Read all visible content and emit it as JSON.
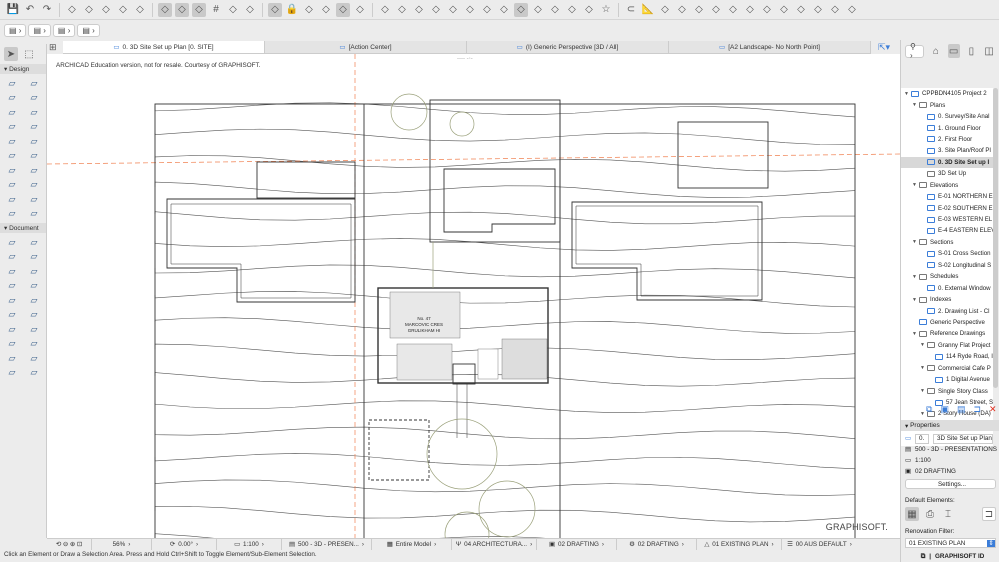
{
  "toolbar": {
    "row1_icons": [
      "save-icon",
      "undo-icon",
      "redo-icon",
      "find-select-icon",
      "marquee-icon",
      "magic-wand-icon",
      "eyedropper-icon",
      "syringe-icon",
      "guide-lines-icon",
      "snap-guides-icon",
      "grid-snap-icon",
      "grid-icon",
      "trace-icon",
      "trace-reference-icon",
      "layer-combo-icon",
      "lock-icon",
      "group-icon",
      "renovation-icon",
      "graphic-override-icon",
      "suspend-groups-icon",
      "intersect-icon",
      "trim-icon",
      "align-icon",
      "corner-icon",
      "fillet-icon",
      "split-icon",
      "roof-icon",
      "mirror-icon",
      "rotate-icon",
      "drag-icon",
      "elevate-icon",
      "offset-icon",
      "resize-icon",
      "star-icon",
      "magnet-icon",
      "ruler-icon",
      "3d-explore-icon",
      "layout-icon",
      "bookmark-icon",
      "tag-icon",
      "label-icon",
      "teamwork-icon",
      "send-icon",
      "receive-icon",
      "publish-icon",
      "reserve-icon",
      "release-icon",
      "sync-icon"
    ],
    "row2_pills": [
      "layers-dropdown",
      "pen-dropdown",
      "3d-view-dropdown",
      "arrow-dropdown"
    ]
  },
  "tabs": [
    {
      "label": "0. 3D Site Set up Plan [0. SITE]",
      "icon": "floor-plan-icon"
    },
    {
      "label": "[Action Center]",
      "icon": "action-center-icon"
    },
    {
      "label": "(I) Generic Perspective [3D / All]",
      "icon": "3d-window-icon"
    },
    {
      "label": "[A2 Landscape- No North Point]",
      "icon": "layout-sheet-icon"
    }
  ],
  "toolbox": {
    "design_label": "Design",
    "document_label": "Document",
    "design_tools": [
      "wall-tool",
      "column-tool",
      "beam-tool",
      "window-tool",
      "door-tool",
      "curtain-wall-tool",
      "slab-tool",
      "roof-tool",
      "stair-tool",
      "railing-tool",
      "shell-tool",
      "skylight-tool",
      "morph-tool",
      "object-tool",
      "mesh-tool",
      "zone-tool",
      "lamp-tool",
      "beam-grid-tool",
      "truss-tool",
      "opening-tool"
    ],
    "document_tools": [
      "dimension-tool",
      "level-dimension-tool",
      "radial-dimension-tool",
      "text-tool",
      "label-tool",
      "fill-tool",
      "line-tool",
      "arc-tool",
      "polyline-tool",
      "spline-tool",
      "hotspot-tool",
      "section-tool",
      "elevation-tool",
      "interior-elevation-tool",
      "worksheet-tool",
      "detail-tool",
      "change-tool",
      "grid-element-tool",
      "figure-tool",
      "drawing-tool"
    ]
  },
  "canvas": {
    "notice": "ARCHICAD Education version, not for resale. Courtesy of GRAPHISOFT.",
    "watermark": "GRAPHISOFT.",
    "building_label": [
      "No. 47",
      "MARCOVIC CRES",
      "GRULIKHAM HI"
    ]
  },
  "navigator": {
    "items": [
      {
        "label": "CPPBDN4105 Project 2",
        "level": 0,
        "tri": true,
        "icon": "project"
      },
      {
        "label": "Plans",
        "level": 1,
        "tri": true,
        "icon": "folder"
      },
      {
        "label": "0. Survey/Site Anal",
        "level": 2,
        "icon": "plan"
      },
      {
        "label": "1. Ground Floor",
        "level": 2,
        "icon": "plan"
      },
      {
        "label": "2. First Floor",
        "level": 2,
        "icon": "plan"
      },
      {
        "label": "3. Site Plan/Roof Pl",
        "level": 2,
        "icon": "plan"
      },
      {
        "label": "0. 3D Site Set up I",
        "level": 2,
        "icon": "plan",
        "selected": true
      },
      {
        "label": "3D Set Up",
        "level": 2,
        "icon": "folder"
      },
      {
        "label": "Elevations",
        "level": 1,
        "tri": true,
        "icon": "folder"
      },
      {
        "label": "E-01 NORTHERN E",
        "level": 2,
        "icon": "plan"
      },
      {
        "label": "E-02 SOUTHERN E",
        "level": 2,
        "icon": "plan"
      },
      {
        "label": "E-03 WESTERN EL",
        "level": 2,
        "icon": "plan"
      },
      {
        "label": "E-4 EASTERN ELEV",
        "level": 2,
        "icon": "plan"
      },
      {
        "label": "Sections",
        "level": 1,
        "tri": true,
        "icon": "folder"
      },
      {
        "label": "S-01 Cross Section",
        "level": 2,
        "icon": "plan"
      },
      {
        "label": "S-02 Longitudinal S",
        "level": 2,
        "icon": "plan"
      },
      {
        "label": "Schedules",
        "level": 1,
        "tri": true,
        "icon": "folder"
      },
      {
        "label": "0. External Window",
        "level": 2,
        "icon": "plan"
      },
      {
        "label": "Indexes",
        "level": 1,
        "tri": true,
        "icon": "folder"
      },
      {
        "label": "2. Drawing List - Cl",
        "level": 2,
        "icon": "plan"
      },
      {
        "label": "Generic Perspective",
        "level": 1,
        "icon": "plan"
      },
      {
        "label": "Reference Drawings",
        "level": 1,
        "tri": true,
        "icon": "folder"
      },
      {
        "label": "Granny Flat Project",
        "level": 2,
        "tri": true,
        "icon": "folder"
      },
      {
        "label": "114 Ryde Road, I",
        "level": 3,
        "icon": "plan"
      },
      {
        "label": "Commercial Cafe P",
        "level": 2,
        "tri": true,
        "icon": "folder"
      },
      {
        "label": "1 Digital Avenue",
        "level": 3,
        "icon": "plan"
      },
      {
        "label": "Single Story Class",
        "level": 2,
        "tri": true,
        "icon": "folder"
      },
      {
        "label": "57 Jean Street, S",
        "level": 3,
        "icon": "plan"
      },
      {
        "label": "2 Story House (DA)",
        "level": 2,
        "tri": true,
        "icon": "folder"
      }
    ]
  },
  "properties": {
    "header": "Properties",
    "id": "0.",
    "name": "3D Site Set up Plan",
    "layer_combo": "500 - 3D - PRESENTATIONS",
    "scale": "1:100",
    "pen_set": "02 DRAFTING",
    "settings_label": "Settings...",
    "default_elements_label": "Default Elements:",
    "renovation_label": "Renovation Filter:",
    "renovation_value": "01 EXISTING PLAN",
    "brand": "GRAPHISOFT ID"
  },
  "status": {
    "zoom": "56%",
    "angle": "0.00°",
    "scale": "1:100",
    "layer_combo": "500 - 3D - PRESEN...",
    "model_view": "Entire Model",
    "structure": "04 ARCHITECTURA...",
    "pen_set": "02 DRAFTING",
    "mvo": "02 DRAFTING",
    "renovation": "01 EXISTING PLAN",
    "dimension": "00 AUS DEFAULT"
  },
  "message": "Click an Element or Draw a Selection Area. Press and Hold Ctrl+Shift to Toggle Element/Sub-Element Selection.",
  "colors": {
    "accent": "#3b7dd8",
    "guide": "#f08050",
    "close": "#e03020"
  }
}
